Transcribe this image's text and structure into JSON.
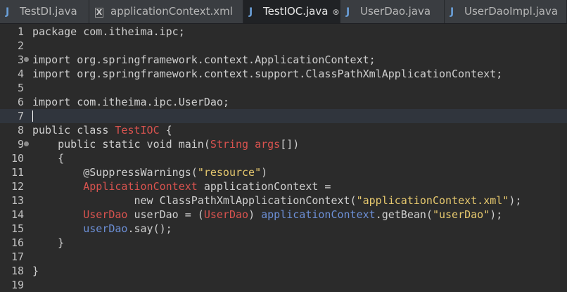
{
  "tabs": [
    {
      "label": "TestDI.java",
      "icon": "J",
      "active": false,
      "closable": false
    },
    {
      "label": "applicationContext.xml",
      "icon": "X",
      "active": false,
      "closable": false
    },
    {
      "label": "TestIOC.java",
      "icon": "J",
      "active": true,
      "closable": true
    },
    {
      "label": "UserDao.java",
      "icon": "J",
      "active": false,
      "closable": false
    },
    {
      "label": "UserDaoImpl.java",
      "icon": "J",
      "active": false,
      "closable": false
    }
  ],
  "tab_close_glyph": "⊗",
  "editor": {
    "current_line": 7,
    "lines": [
      {
        "n": "1",
        "segments": [
          {
            "t": "package com.itheima.ipc;",
            "c": "kw"
          }
        ]
      },
      {
        "n": "2",
        "segments": []
      },
      {
        "n": "3",
        "fold": true,
        "segments": [
          {
            "t": "import org.springframework.context.ApplicationContext;",
            "c": "kw"
          }
        ]
      },
      {
        "n": "4",
        "segments": [
          {
            "t": "import org.springframework.context.support.ClassPathXmlApplicationContext;",
            "c": "kw"
          }
        ]
      },
      {
        "n": "5",
        "segments": []
      },
      {
        "n": "6",
        "segments": [
          {
            "t": "import com.itheima.ipc.UserDao;",
            "c": "kw"
          }
        ]
      },
      {
        "n": "7",
        "segments": []
      },
      {
        "n": "8",
        "segments": [
          {
            "t": "public class ",
            "c": "kw"
          },
          {
            "t": "TestIOC",
            "c": "ty"
          },
          {
            "t": " {",
            "c": "kw"
          }
        ]
      },
      {
        "n": "9",
        "fold": true,
        "segments": [
          {
            "t": "    public static void main(",
            "c": "kw"
          },
          {
            "t": "String",
            "c": "ty"
          },
          {
            "t": " ",
            "c": "kw"
          },
          {
            "t": "args",
            "c": "ty"
          },
          {
            "t": "[])",
            "c": "kw"
          }
        ]
      },
      {
        "n": "10",
        "segments": [
          {
            "t": "    {",
            "c": "kw"
          }
        ]
      },
      {
        "n": "11",
        "segments": [
          {
            "t": "        @SuppressWarnings(",
            "c": "kw"
          },
          {
            "t": "\"resource\"",
            "c": "st"
          },
          {
            "t": ")",
            "c": "kw"
          }
        ]
      },
      {
        "n": "12",
        "segments": [
          {
            "t": "        ApplicationContext",
            "c": "ty"
          },
          {
            "t": " applicationContext =",
            "c": "kw"
          }
        ]
      },
      {
        "n": "13",
        "segments": [
          {
            "t": "                new ClassPathXmlApplicationContext(",
            "c": "kw"
          },
          {
            "t": "\"applicationContext.xml\"",
            "c": "st"
          },
          {
            "t": ");",
            "c": "kw"
          }
        ]
      },
      {
        "n": "14",
        "segments": [
          {
            "t": "        UserDao",
            "c": "ty"
          },
          {
            "t": " userDao = (",
            "c": "kw"
          },
          {
            "t": "UserDao",
            "c": "ty"
          },
          {
            "t": ") ",
            "c": "kw"
          },
          {
            "t": "applicationContext",
            "c": "field"
          },
          {
            "t": ".getBean(",
            "c": "kw"
          },
          {
            "t": "\"userDao\"",
            "c": "st"
          },
          {
            "t": ");",
            "c": "kw"
          }
        ]
      },
      {
        "n": "15",
        "segments": [
          {
            "t": "        userDao",
            "c": "field"
          },
          {
            "t": ".say();",
            "c": "kw"
          }
        ]
      },
      {
        "n": "16",
        "segments": [
          {
            "t": "    }",
            "c": "kw"
          }
        ]
      },
      {
        "n": "17",
        "segments": []
      },
      {
        "n": "18",
        "segments": [
          {
            "t": "}",
            "c": "kw"
          }
        ]
      },
      {
        "n": "19",
        "segments": []
      }
    ]
  },
  "colors": {
    "background": "#2b2b2b",
    "keyword": "#cfcfcf",
    "type": "#d9534f",
    "string": "#e6c86e",
    "field": "#6c8fd6",
    "current_line": "#30353d"
  }
}
